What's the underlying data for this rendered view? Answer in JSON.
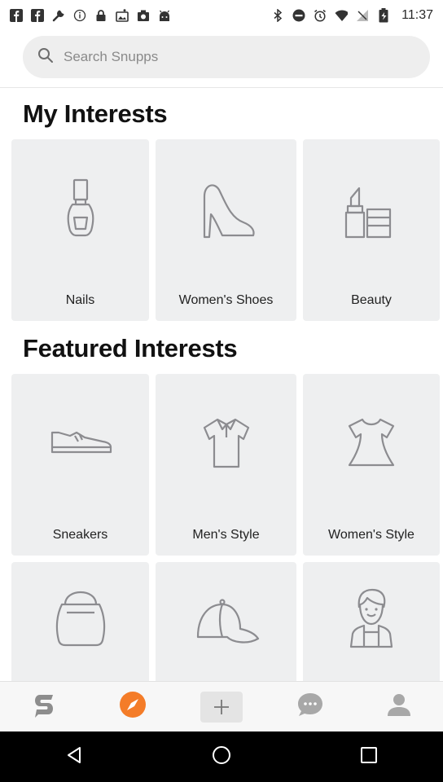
{
  "status_bar": {
    "time": "11:37",
    "left_icons": [
      "facebook-icon",
      "facebook-icon",
      "wrench-icon",
      "info-icon",
      "lock-icon",
      "photo-icon",
      "camera-icon",
      "android-icon"
    ],
    "right_icons": [
      "bluetooth-icon",
      "do-not-disturb-icon",
      "alarm-icon",
      "wifi-icon",
      "no-signal-icon",
      "battery-icon"
    ]
  },
  "search": {
    "placeholder": "Search Snupps"
  },
  "sections": {
    "my_interests": {
      "title": "My Interests",
      "items": [
        {
          "label": "Nails",
          "icon": "nail-polish-icon"
        },
        {
          "label": "Women's Shoes",
          "icon": "high-heel-icon"
        },
        {
          "label": "Beauty",
          "icon": "lipstick-icon"
        }
      ]
    },
    "featured_interests": {
      "title": "Featured Interests",
      "items": [
        {
          "label": "Sneakers",
          "icon": "sneaker-icon"
        },
        {
          "label": "Men's Style",
          "icon": "polo-shirt-icon"
        },
        {
          "label": "Women's Style",
          "icon": "dress-icon"
        },
        {
          "label": "",
          "icon": "handbag-icon"
        },
        {
          "label": "",
          "icon": "cap-icon"
        },
        {
          "label": "",
          "icon": "person-icon"
        }
      ]
    }
  },
  "bottom_nav": {
    "items": [
      "snupps-logo-icon",
      "explore-compass-icon",
      "add-icon",
      "chat-icon",
      "profile-icon"
    ],
    "active": "explore-compass-icon",
    "accent_color": "#f47c28"
  },
  "system_nav": [
    "back-icon",
    "home-icon",
    "recents-icon"
  ]
}
